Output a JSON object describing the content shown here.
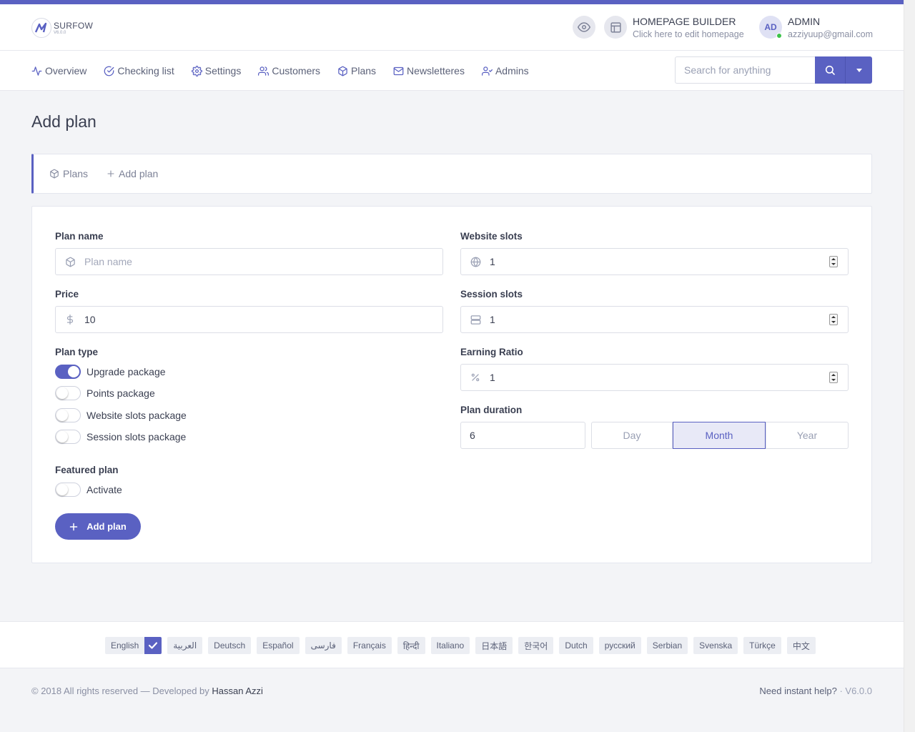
{
  "brand": {
    "name": "SURFOW",
    "version": "V6.0.0"
  },
  "header": {
    "builder_title": "HOMEPAGE BUILDER",
    "builder_sub": "Click here to edit homepage",
    "avatar_initials": "AD",
    "user_name": "ADMIN",
    "user_email": "azziyuup@gmail.com"
  },
  "nav": {
    "items": [
      {
        "label": "Overview",
        "icon": "activity-icon"
      },
      {
        "label": "Checking list",
        "icon": "check-circle-icon"
      },
      {
        "label": "Settings",
        "icon": "gear-icon"
      },
      {
        "label": "Customers",
        "icon": "users-icon"
      },
      {
        "label": "Plans",
        "icon": "box-icon"
      },
      {
        "label": "Newsletteres",
        "icon": "mail-icon"
      },
      {
        "label": "Admins",
        "icon": "user-check-icon"
      }
    ],
    "search_placeholder": "Search for anything"
  },
  "page": {
    "title": "Add plan"
  },
  "breadcrumb": {
    "items": [
      "Plans",
      "Add plan"
    ]
  },
  "form": {
    "plan_name": {
      "label": "Plan name",
      "placeholder": "Plan name",
      "value": ""
    },
    "price": {
      "label": "Price",
      "value": "10"
    },
    "plan_type": {
      "label": "Plan type",
      "options": [
        {
          "label": "Upgrade package",
          "on": true
        },
        {
          "label": "Points package",
          "on": false
        },
        {
          "label": "Website slots package",
          "on": false
        },
        {
          "label": "Session slots package",
          "on": false
        }
      ]
    },
    "featured": {
      "label": "Featured plan",
      "toggle_label": "Activate",
      "on": false
    },
    "website_slots": {
      "label": "Website slots",
      "value": "1"
    },
    "session_slots": {
      "label": "Session slots",
      "value": "1"
    },
    "earning_ratio": {
      "label": "Earning Ratio",
      "value": "1"
    },
    "plan_duration": {
      "label": "Plan duration",
      "value": "6",
      "units": [
        "Day",
        "Month",
        "Year"
      ],
      "selected": "Month"
    },
    "submit_label": "Add plan"
  },
  "languages": {
    "items": [
      "English",
      "العربية",
      "Deutsch",
      "Español",
      "فارسی",
      "Français",
      "हिन्दी",
      "Italiano",
      "日本語",
      "한국어",
      "Dutch",
      "русский",
      "Serbian",
      "Svenska",
      "Türkçe",
      "中文"
    ],
    "selected": "English"
  },
  "footer": {
    "copyright": "© 2018 All rights reserved — Developed by",
    "developer": "Hassan Azzi",
    "help": "Need instant help?",
    "separator": "·",
    "version": "V6.0.0"
  },
  "colors": {
    "accent": "#5a61c2",
    "online": "#3cc24a"
  }
}
